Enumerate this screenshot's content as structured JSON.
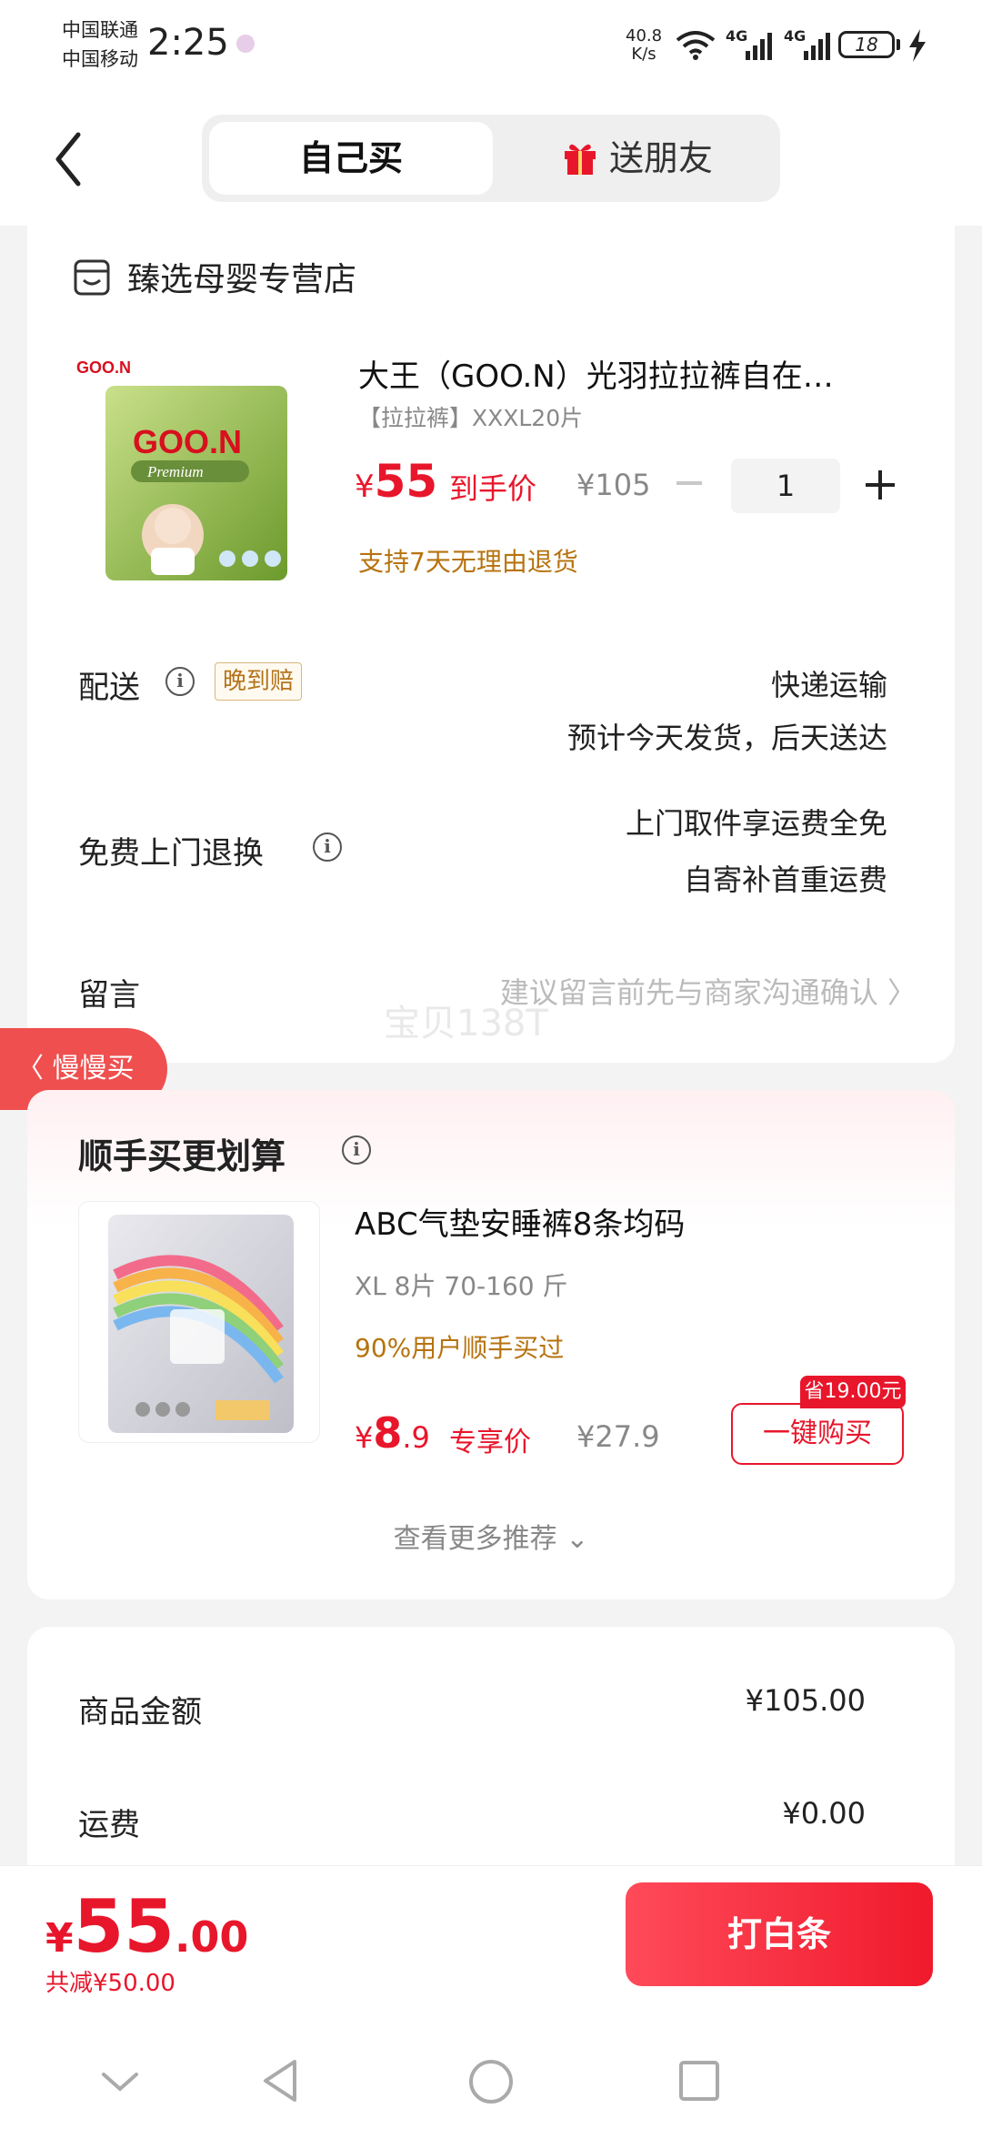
{
  "status_bar": {
    "carrier_1": "中国联通",
    "carrier_2": "中国移动",
    "time": "2:25",
    "net_speed_value": "40.8",
    "net_speed_unit": "K/s",
    "signal_1": "4G",
    "signal_2": "4G",
    "battery": "18"
  },
  "header": {
    "tab_self": "自己买",
    "tab_gift": "送朋友"
  },
  "store": {
    "name": "臻选母婴专营店"
  },
  "product": {
    "title": "大王（GOO.N）光羽拉拉裤自在…",
    "spec": "【拉拉裤】XXXL20片",
    "price_symbol": "¥",
    "price": "55",
    "price_tag": "到手价",
    "original_price": "¥105",
    "quantity": "1",
    "return_note": "支持7天无理由退货",
    "brand_text": "GOO.N",
    "series_text": "Premium"
  },
  "delivery": {
    "label": "配送",
    "badge": "晚到赔",
    "method": "快递运输",
    "estimate": "预计今天发货，后天送达"
  },
  "free_return": {
    "label": "免费上门退换",
    "line1": "上门取件享运费全免",
    "line2": "自寄补首重运费"
  },
  "message": {
    "label": "留言",
    "placeholder": "建议留言前先与商家沟通确认 〉",
    "watermark": "宝贝138T"
  },
  "slow_buy": {
    "label": "慢慢买"
  },
  "recommend": {
    "title": "顺手买更划算",
    "item_title": "ABC气垫安睡裤8条均码",
    "item_spec": "XL 8片 70-160 斤",
    "item_note": "90%用户顺手买过",
    "price_symbol": "¥",
    "price_int": "8",
    "price_dec": ".9",
    "price_tag": "专享价",
    "original_price": "¥27.9",
    "save_badge": "省19.00元",
    "buy_button": "一键购买",
    "more": "查看更多推荐 ⌄"
  },
  "summary": {
    "goods_label": "商品金额",
    "goods_value": "¥105.00",
    "shipping_label": "运费",
    "shipping_value": "¥0.00"
  },
  "bottom": {
    "total_symbol": "¥",
    "total_int": "55",
    "total_dec": ".00",
    "discount": "共减¥50.00",
    "pay_button": "打白条"
  },
  "colors": {
    "accent": "#e8162b",
    "note": "#b6730f",
    "muted": "#888888"
  }
}
